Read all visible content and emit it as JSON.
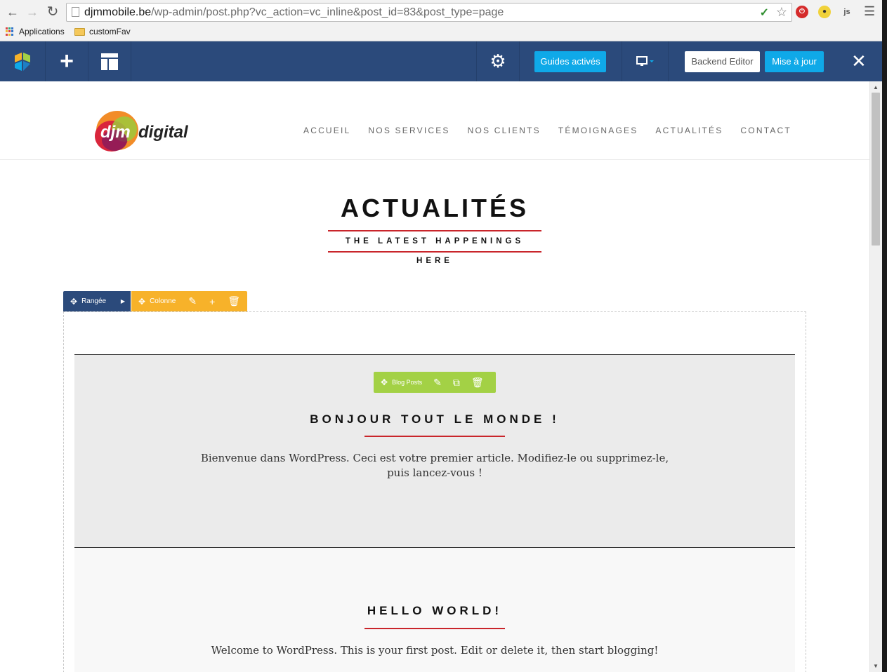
{
  "browser": {
    "url_host": "djmmobile.be",
    "url_path": "/wp-admin/post.php?vc_action=vc_inline&post_id=83&post_type=page",
    "ext_js": "js",
    "bookmarks": [
      {
        "label": "Applications"
      },
      {
        "label": "customFav"
      }
    ]
  },
  "vc_toolbar": {
    "guides_label": "Guides activés",
    "backend_label": "Backend Editor",
    "update_label": "Mise à jour",
    "icons": [
      "vc-logo-icon",
      "plus-icon",
      "templates-icon",
      "gear-icon",
      "desktop-icon",
      "close-icon"
    ]
  },
  "site": {
    "logo_text_1": "djm",
    "logo_text_2": "digital",
    "nav": [
      "ACCUEIL",
      "NOS SERVICES",
      "NOS CLIENTS",
      "TÉMOIGNAGES",
      "ACTUALITÉS",
      "CONTACT"
    ],
    "heading": "ACTUALITÉS",
    "subtitle": "THE LATEST HAPPENINGS HERE"
  },
  "builder": {
    "row_label": "Rangée",
    "column_label": "Colonne",
    "element_label": "Blog Posts"
  },
  "posts": [
    {
      "title": "BONJOUR TOUT LE MONDE !",
      "excerpt": "Bienvenue dans WordPress. Ceci est votre premier article. Modifiez-le ou supprimez-le, puis lancez-vous !"
    },
    {
      "title": "HELLO WORLD!",
      "excerpt": "Welcome to WordPress. This is your first post. Edit or delete it, then start blogging!"
    }
  ],
  "colors": {
    "vc_blue": "#2b4a7b",
    "accent_blue": "#0fa9e8",
    "column_orange": "#f7b22a",
    "element_green": "#a3d145",
    "heading_red": "#c9252b"
  }
}
